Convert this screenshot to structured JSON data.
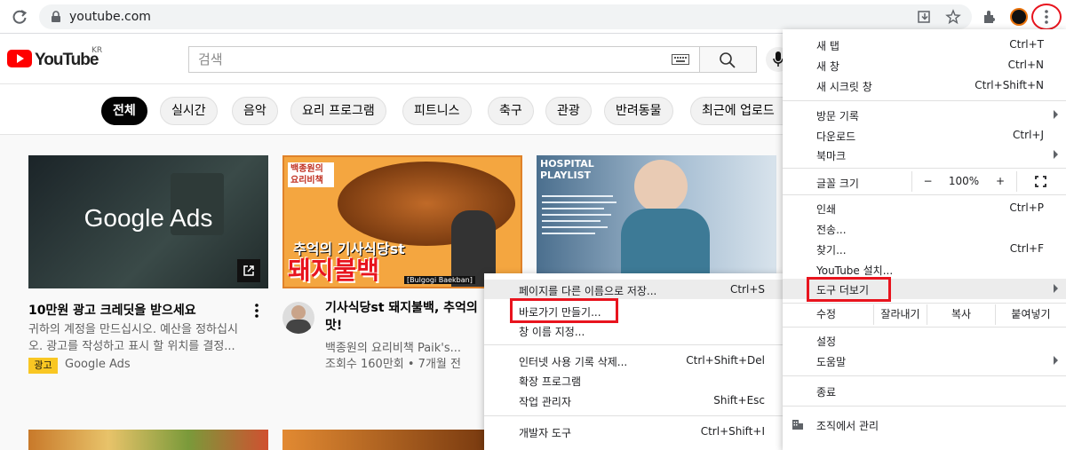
{
  "browser": {
    "url": "youtube.com"
  },
  "youtube": {
    "logo_text": "YouTube",
    "region": "KR",
    "search_placeholder": "검색"
  },
  "chips": [
    "전체",
    "실시간",
    "음악",
    "요리 프로그램",
    "피트니스",
    "축구",
    "관광",
    "반려동물",
    "최근에 업로드"
  ],
  "videos": {
    "v1": {
      "thumb_text": "Google Ads",
      "title": "10만원 광고 크레딧을 받으세요",
      "desc_line1": "귀하의 계정을 만드십시오. 예산을 정하십시",
      "desc_line2": "오. 광고를 작성하고 표시 할 위치를 결정...",
      "badge": "광고",
      "channel": "Google Ads"
    },
    "v2": {
      "thumb_top": "백종원의 요리비책",
      "thumb_mid": "추억의 기사식당st",
      "thumb_big": "돼지불백",
      "thumb_tag": "[Bulgogi Baekban]",
      "title_line1": "기사식당st 돼지불백, 추억의",
      "title_line2": "맛!",
      "channel": "백종원의 요리비책 Paik's...",
      "stats": "조회수 160만회 • 7개월 전"
    },
    "v3": {
      "thumb_title": "HOSPITAL PLAYLIST"
    }
  },
  "chrome_menu": {
    "new_tab": "새 탭",
    "new_tab_sc": "Ctrl+T",
    "new_window": "새 창",
    "new_window_sc": "Ctrl+N",
    "incognito": "새 시크릿 창",
    "incognito_sc": "Ctrl+Shift+N",
    "history": "방문 기록",
    "downloads": "다운로드",
    "downloads_sc": "Ctrl+J",
    "bookmarks": "북마크",
    "zoom_label": "글꼴 크기",
    "zoom_minus": "−",
    "zoom_value": "100%",
    "zoom_plus": "+",
    "print": "인쇄",
    "print_sc": "Ctrl+P",
    "cast": "전송...",
    "find": "찾기...",
    "find_sc": "Ctrl+F",
    "install": "YouTube 설치...",
    "more_tools": "도구 더보기",
    "edit": "수정",
    "cut": "잘라내기",
    "copy": "복사",
    "paste": "붙여넣기",
    "settings": "설정",
    "help": "도움말",
    "exit": "종료",
    "managed": "조직에서 관리"
  },
  "more_tools_menu": {
    "save_page": "페이지를 다른 이름으로 저장...",
    "save_page_sc": "Ctrl+S",
    "create_shortcut": "바로가기 만들기...",
    "name_window": "창 이름 지정...",
    "clear_data": "인터넷 사용 기록 삭제...",
    "clear_data_sc": "Ctrl+Shift+Del",
    "extensions": "확장 프로그램",
    "task_manager": "작업 관리자",
    "task_manager_sc": "Shift+Esc",
    "dev_tools": "개발자 도구",
    "dev_tools_sc": "Ctrl+Shift+I"
  },
  "colors": {
    "highlight_red": "#e8141e",
    "youtube_red": "#ff0000",
    "ad_yellow": "#f9c723"
  }
}
